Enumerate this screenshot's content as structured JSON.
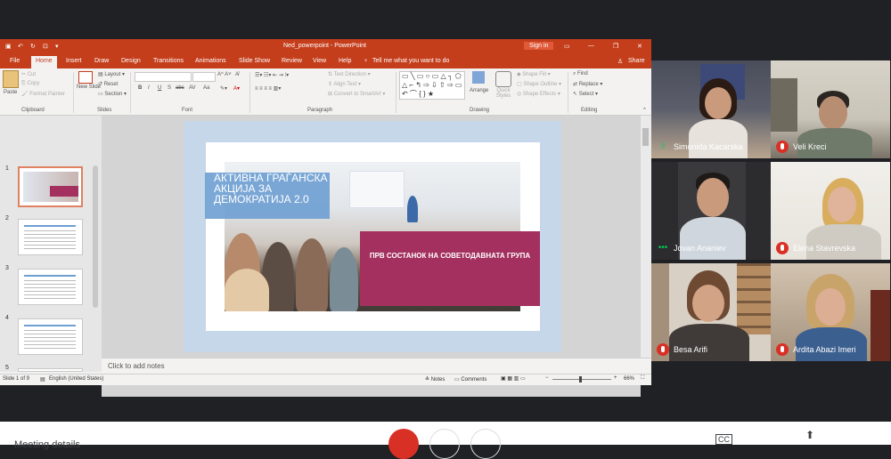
{
  "powerpoint": {
    "document_title": "Ned_powerpoint - PowerPoint",
    "sign_in_label": "Sign in",
    "tabs": [
      {
        "label": "File"
      },
      {
        "label": "Home"
      },
      {
        "label": "Insert"
      },
      {
        "label": "Draw"
      },
      {
        "label": "Design"
      },
      {
        "label": "Transitions"
      },
      {
        "label": "Animations"
      },
      {
        "label": "Slide Show"
      },
      {
        "label": "Review"
      },
      {
        "label": "View"
      },
      {
        "label": "Help"
      }
    ],
    "tell_me": "Tell me what you want to do",
    "share_label": "Share",
    "ribbon": {
      "paste": "Paste",
      "cut": "Cut",
      "copy": "Copy",
      "format_painter": "Format Painter",
      "clipboard": "Clipboard",
      "new_slide": "New Slide",
      "layout": "Layout",
      "reset": "Reset",
      "section": "Section",
      "slides": "Slides",
      "font": "Font",
      "paragraph": "Paragraph",
      "text_direction": "Text Direction",
      "align_text": "Align Text",
      "convert_smartart": "Convert to SmartArt",
      "arrange": "Arrange",
      "quick_styles": "Quick Styles",
      "shape_fill": "Shape Fill",
      "shape_outline": "Shape Outline",
      "shape_effects": "Shape Effects",
      "drawing": "Drawing",
      "find": "Find",
      "replace": "Replace",
      "select": "Select",
      "editing": "Editing",
      "bold": "B",
      "italic": "I",
      "underline": "U",
      "strike": "S",
      "abc": "abc",
      "av": "AV",
      "aa": "Aa"
    },
    "thumbnails": [
      {
        "num": "1"
      },
      {
        "num": "2"
      },
      {
        "num": "3"
      },
      {
        "num": "4"
      },
      {
        "num": "5"
      }
    ],
    "slide": {
      "title_text": "АКТИВНА ГРАЃАНСКА АКЦИЈА ЗА ДЕМОКРАТИЈА 2.0",
      "subtitle_text": "ПРВ СОСТАНОК НА СОВЕТОДАВНАТА ГРУПА"
    },
    "notes_placeholder": "Click to add notes",
    "status": {
      "slide_count": "Slide 1 of 9",
      "language": "English (United States)",
      "notes": "Notes",
      "comments": "Comments",
      "zoom": "66%"
    }
  },
  "meeting": {
    "participants": [
      {
        "name": "Simonida Kacarska",
        "muted": false,
        "speaking": true
      },
      {
        "name": "Veli Kreci",
        "muted": true,
        "speaking": false
      },
      {
        "name": "Jovan Ananiev",
        "muted": false,
        "speaking": true
      },
      {
        "name": "Elena Stavrevska",
        "muted": true,
        "speaking": false
      },
      {
        "name": "Besa Arifi",
        "muted": true,
        "speaking": false
      },
      {
        "name": "Ardita Abazi Imeri",
        "muted": true,
        "speaking": false
      }
    ],
    "bottom_left_label": "Meeting details"
  },
  "colors": {
    "ppt_accent": "#c43e1c",
    "slide_pink": "#a3305f",
    "slide_blue": "#6d9fd1",
    "mute_red": "#d93025",
    "speaking_green": "#00c853"
  }
}
